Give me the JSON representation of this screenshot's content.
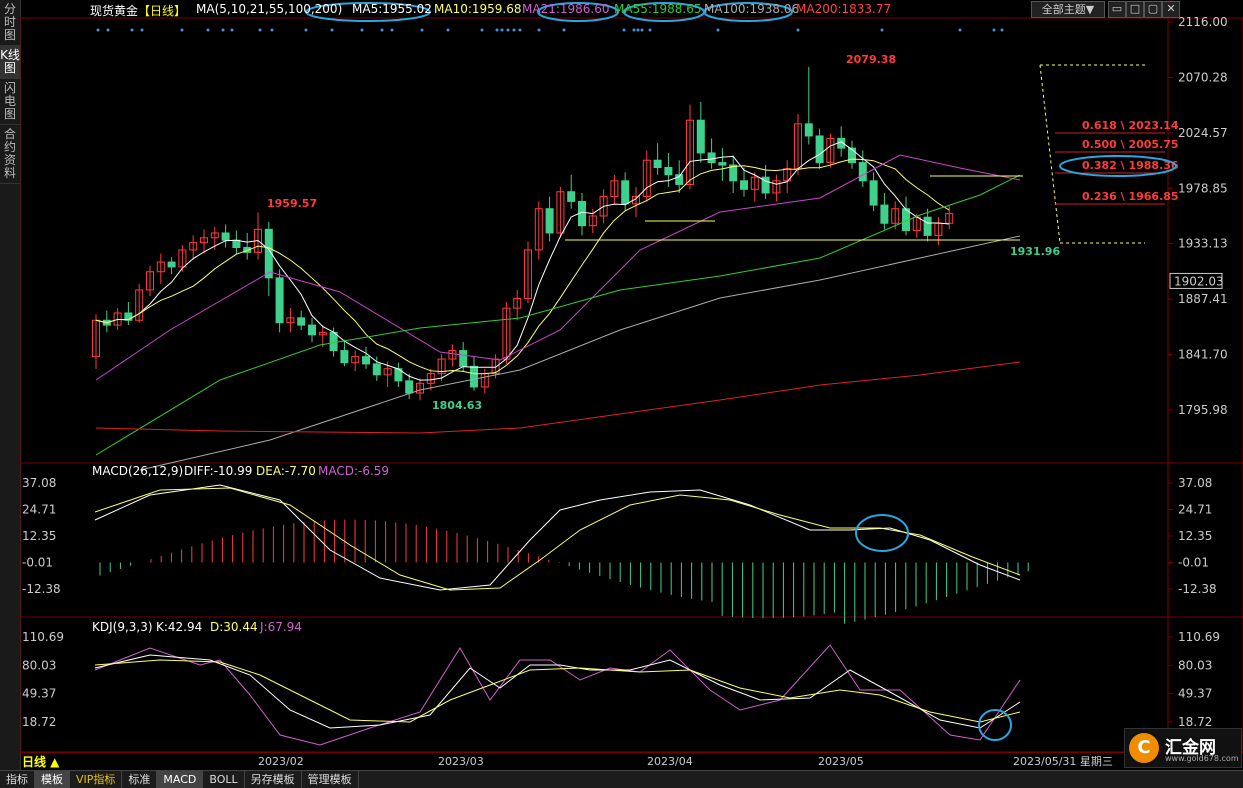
{
  "sidebar": {
    "items": [
      "分时图",
      "K线图",
      "闪电图",
      "合约资料"
    ]
  },
  "header": {
    "symbol": "现货黄金",
    "period_tag": "【日线】",
    "ma_title": "MA(5,10,21,55,100,200)",
    "ma5": "MA5:1955.02",
    "ma10": "MA10:1959.68",
    "ma21": "MA21:1986.60",
    "ma55": "MA55:1988.65",
    "ma100": "MA100:1938.06",
    "ma200": "MA200:1833.77",
    "theme_select": "全部主题",
    "theme_arrow": "▼"
  },
  "price_axis": [
    "2116.00",
    "2070.28",
    "2024.57",
    "1978.85",
    "1933.13",
    "1887.41",
    "1841.70",
    "1795.98"
  ],
  "current_price": "1902.03",
  "annotations": {
    "high_2079": "2079.38",
    "high_1959": "1959.57",
    "low_1804": "1804.63",
    "low_1931": "1931.96",
    "fib_0618": "0.618 \\ 2023.14",
    "fib_0500": "0.500 \\ 2005.75",
    "fib_0382": "0.382 \\ 1988.36",
    "fib_0236": "0.236 \\ 1966.85"
  },
  "macd": {
    "title": "MACD(26,12,9)",
    "diff": "DIFF:-10.99",
    "dea": "DEA:-7.70",
    "macd": "MACD:-6.59",
    "axis": [
      "37.08",
      "24.71",
      "12.35",
      "-0.01",
      "-12.38"
    ]
  },
  "kdj": {
    "title": "KDJ(9,3,3)",
    "k": "K:42.94",
    "d": "D:30.44",
    "j": "J:67.94",
    "axis": [
      "110.69",
      "80.03",
      "49.37",
      "18.72"
    ]
  },
  "dates": [
    "2023/02",
    "2023/03",
    "2023/04",
    "2023/05"
  ],
  "period": "日线 ▲",
  "date_status": "2023/05/31 星期三",
  "logo": {
    "glyph": "C",
    "name": "汇金网",
    "url": "www.gold678.com"
  },
  "bottom_tabs": [
    "指标",
    "模板",
    "VIP指标",
    "标准",
    "MACD",
    "BOLL",
    "另存模板",
    "管理模板"
  ],
  "colors": {
    "up": "#ff3b3b",
    "down": "#3fd08c",
    "ma5": "#ffffff",
    "ma10": "#ffff66",
    "ma21": "#cc44cc",
    "ma55": "#33cc33",
    "ma100": "#aaaaaa",
    "ma200": "#dd2222",
    "highlight": "#2aa6e0"
  },
  "chart_data": {
    "type": "candlestick",
    "price_range": [
      1780,
      2125
    ],
    "candles": [
      [
        1840,
        1875,
        1830,
        1870
      ],
      [
        1870,
        1878,
        1860,
        1866
      ],
      [
        1866,
        1880,
        1862,
        1876
      ],
      [
        1876,
        1885,
        1866,
        1870
      ],
      [
        1870,
        1900,
        1868,
        1895
      ],
      [
        1895,
        1915,
        1890,
        1910
      ],
      [
        1910,
        1925,
        1900,
        1918
      ],
      [
        1918,
        1922,
        1908,
        1914
      ],
      [
        1914,
        1932,
        1910,
        1928
      ],
      [
        1928,
        1940,
        1920,
        1934
      ],
      [
        1934,
        1945,
        1925,
        1938
      ],
      [
        1938,
        1947,
        1928,
        1942
      ],
      [
        1942,
        1949,
        1930,
        1936
      ],
      [
        1936,
        1944,
        1924,
        1930
      ],
      [
        1930,
        1942,
        1920,
        1926
      ],
      [
        1926,
        1959,
        1920,
        1945
      ],
      [
        1945,
        1951,
        1890,
        1905
      ],
      [
        1905,
        1912,
        1860,
        1868
      ],
      [
        1868,
        1880,
        1860,
        1872
      ],
      [
        1872,
        1878,
        1862,
        1866
      ],
      [
        1866,
        1872,
        1852,
        1858
      ],
      [
        1858,
        1866,
        1848,
        1860
      ],
      [
        1860,
        1864,
        1840,
        1845
      ],
      [
        1845,
        1854,
        1832,
        1835
      ],
      [
        1835,
        1845,
        1828,
        1840
      ],
      [
        1840,
        1848,
        1830,
        1834
      ],
      [
        1834,
        1840,
        1820,
        1825
      ],
      [
        1825,
        1836,
        1815,
        1830
      ],
      [
        1830,
        1835,
        1815,
        1820
      ],
      [
        1820,
        1826,
        1805,
        1810
      ],
      [
        1810,
        1822,
        1804,
        1818
      ],
      [
        1818,
        1830,
        1812,
        1826
      ],
      [
        1826,
        1842,
        1820,
        1838
      ],
      [
        1838,
        1850,
        1832,
        1845
      ],
      [
        1845,
        1852,
        1828,
        1832
      ],
      [
        1832,
        1840,
        1812,
        1815
      ],
      [
        1815,
        1830,
        1810,
        1826
      ],
      [
        1826,
        1842,
        1822,
        1838
      ],
      [
        1838,
        1885,
        1834,
        1880
      ],
      [
        1880,
        1895,
        1870,
        1888
      ],
      [
        1888,
        1935,
        1884,
        1928
      ],
      [
        1928,
        1968,
        1920,
        1962
      ],
      [
        1962,
        1972,
        1935,
        1942
      ],
      [
        1942,
        1980,
        1938,
        1976
      ],
      [
        1976,
        1990,
        1962,
        1968
      ],
      [
        1968,
        1975,
        1940,
        1948
      ],
      [
        1948,
        1962,
        1942,
        1956
      ],
      [
        1956,
        1978,
        1950,
        1972
      ],
      [
        1972,
        1990,
        1966,
        1985
      ],
      [
        1985,
        1992,
        1960,
        1966
      ],
      [
        1966,
        1980,
        1955,
        1972
      ],
      [
        1972,
        2010,
        1968,
        2002
      ],
      [
        2002,
        2016,
        1990,
        1996
      ],
      [
        1996,
        2008,
        1980,
        1990
      ],
      [
        1990,
        2002,
        1975,
        1982
      ],
      [
        1982,
        2048,
        1978,
        2035
      ],
      [
        2035,
        2050,
        2000,
        2008
      ],
      [
        2008,
        2020,
        1995,
        2000
      ],
      [
        2000,
        2012,
        1985,
        1998
      ],
      [
        1998,
        2006,
        1975,
        1985
      ],
      [
        1985,
        1996,
        1972,
        1978
      ],
      [
        1978,
        1992,
        1968,
        1988
      ],
      [
        1988,
        1998,
        1970,
        1975
      ],
      [
        1975,
        1990,
        1968,
        1985
      ],
      [
        1985,
        2002,
        1975,
        1995
      ],
      [
        1995,
        2040,
        1990,
        2032
      ],
      [
        2032,
        2079,
        2015,
        2022
      ],
      [
        2022,
        2028,
        1995,
        2000
      ],
      [
        2000,
        2024,
        1996,
        2020
      ],
      [
        2020,
        2030,
        2005,
        2012
      ],
      [
        2012,
        2018,
        1995,
        2000
      ],
      [
        2000,
        2010,
        1980,
        1985
      ],
      [
        1985,
        1992,
        1960,
        1965
      ],
      [
        1965,
        1975,
        1945,
        1950
      ],
      [
        1950,
        1968,
        1945,
        1962
      ],
      [
        1962,
        1972,
        1940,
        1944
      ],
      [
        1944,
        1958,
        1938,
        1955
      ],
      [
        1955,
        1962,
        1935,
        1940
      ],
      [
        1940,
        1955,
        1932,
        1950
      ],
      [
        1950,
        1965,
        1945,
        1958
      ]
    ],
    "series_ma5_last": 1955.02,
    "series_ma10_last": 1959.68,
    "series_ma21_last": 1986.6,
    "series_ma55_last": 1988.65,
    "series_ma100_last": 1938.06,
    "series_ma200_last": 1833.77
  }
}
